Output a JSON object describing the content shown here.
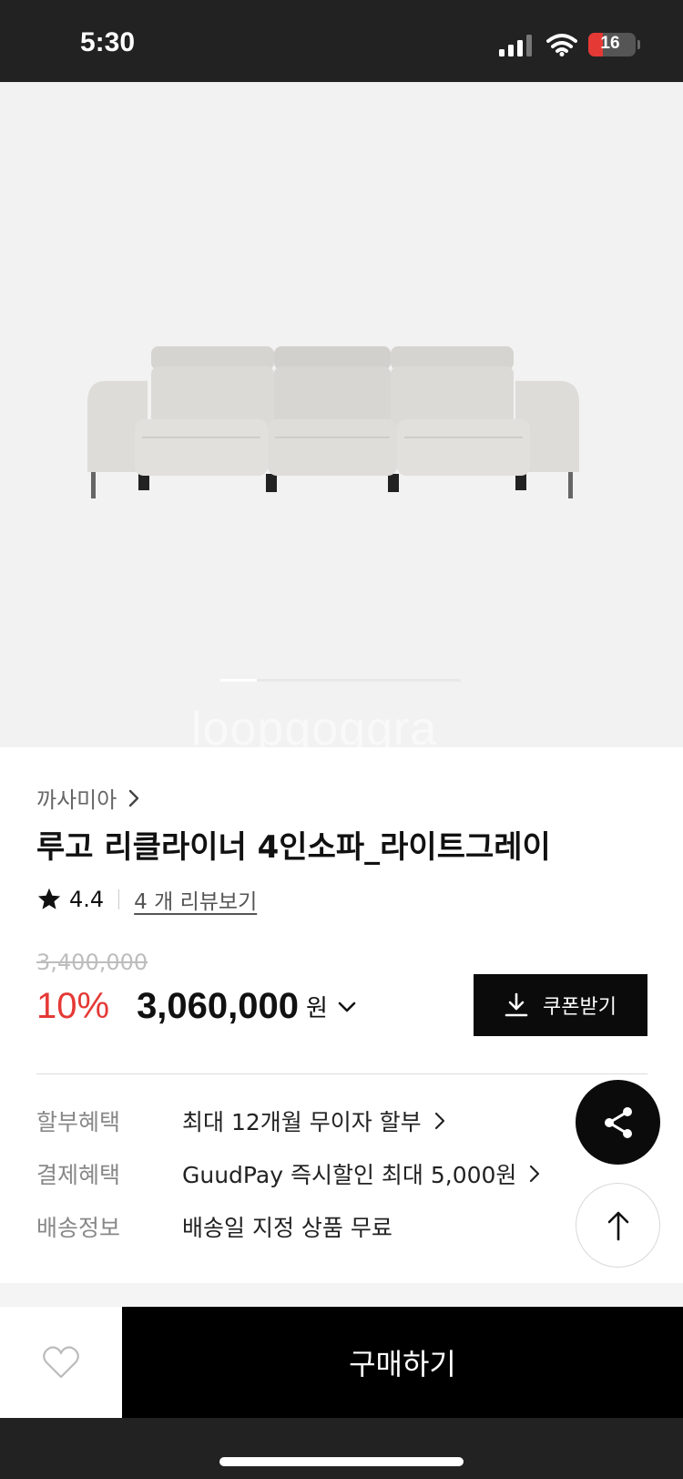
{
  "status_bar": {
    "time": "5:30",
    "battery_level": "16",
    "icons": [
      "signal-icon",
      "wifi-icon",
      "battery-charging-icon"
    ]
  },
  "gallery": {
    "image": "sofa-product-image",
    "watermark": "loopgoggra",
    "slide_progress": 0.15
  },
  "product": {
    "brand": "까사미아",
    "title": "루고 리클라이너 4인소파_라이트그레이",
    "rating": "4.4",
    "review_link": "4 개 리뷰보기",
    "original_price": "3,400,000",
    "discount": "10%",
    "price": "3,060,000",
    "currency": "원"
  },
  "coupon": {
    "label": "쿠폰받기"
  },
  "benefits": [
    {
      "label": "할부혜택",
      "value": "최대 12개월 무이자 할부",
      "has_arrow": true
    },
    {
      "label": "결제혜택",
      "value": "GuudPay 즉시할인 최대 5,000원",
      "has_arrow": true
    },
    {
      "label": "배송정보",
      "value": "배송일 지정 상품 무료",
      "has_arrow": false
    }
  ],
  "actions": {
    "buy_label": "구매하기"
  },
  "colors": {
    "accent_discount": "#e53935",
    "primary_button": "#000000",
    "status_bar_bg": "#222222"
  }
}
